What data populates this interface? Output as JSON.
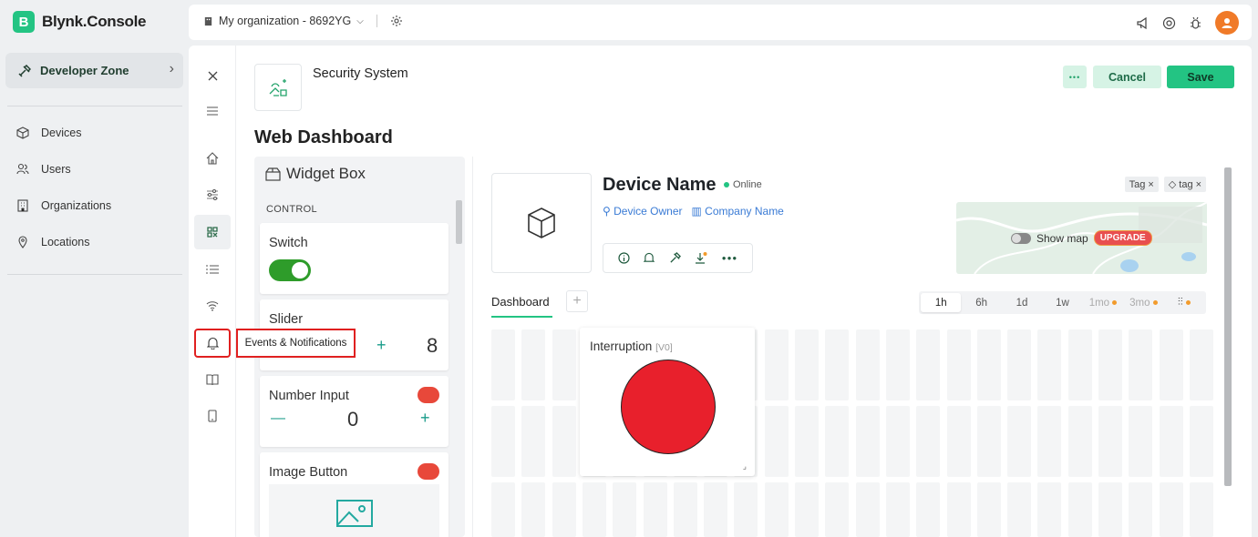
{
  "app": {
    "logo_letter": "B",
    "name": "Blynk.Console"
  },
  "sidebar": {
    "dev_zone": "Developer Zone",
    "items": [
      {
        "label": "Devices",
        "icon": "cube-icon"
      },
      {
        "label": "Users",
        "icon": "users-icon"
      },
      {
        "label": "Organizations",
        "icon": "building-icon"
      },
      {
        "label": "Locations",
        "icon": "pin-icon"
      }
    ]
  },
  "header": {
    "org_name": "My organization - 8692YG"
  },
  "template": {
    "name": "Security System",
    "more_label": "•••",
    "cancel_label": "Cancel",
    "save_label": "Save"
  },
  "page_title": "Web Dashboard",
  "widget_box": {
    "title": "Widget Box",
    "category": "CONTROL",
    "cards": [
      {
        "title": "Switch"
      },
      {
        "title": "Slider",
        "minus": "—",
        "plus": "+",
        "value": "8"
      },
      {
        "title": "Number Input",
        "minus": "—",
        "plus": "+",
        "value": "0"
      },
      {
        "title": "Image Button"
      }
    ]
  },
  "tooltip": "Events & Notifications",
  "device": {
    "name": "Device Name",
    "status": "Online",
    "owner": "Device Owner",
    "company": "Company Name",
    "tags": [
      "Tag",
      "tag"
    ],
    "tag_remove": "×",
    "show_map": "Show map",
    "upgrade": "UPGRADE"
  },
  "dashboard": {
    "tab": "Dashboard",
    "add": "+",
    "ranges": [
      "1h",
      "6h",
      "1d",
      "1w",
      "1mo",
      "3mo"
    ],
    "active_range": "1h",
    "widget": {
      "title": "Interruption",
      "pin": "[V0]"
    }
  },
  "colors": {
    "brand": "#23c483",
    "led": "#e8202c",
    "highlight": "#e02020"
  }
}
